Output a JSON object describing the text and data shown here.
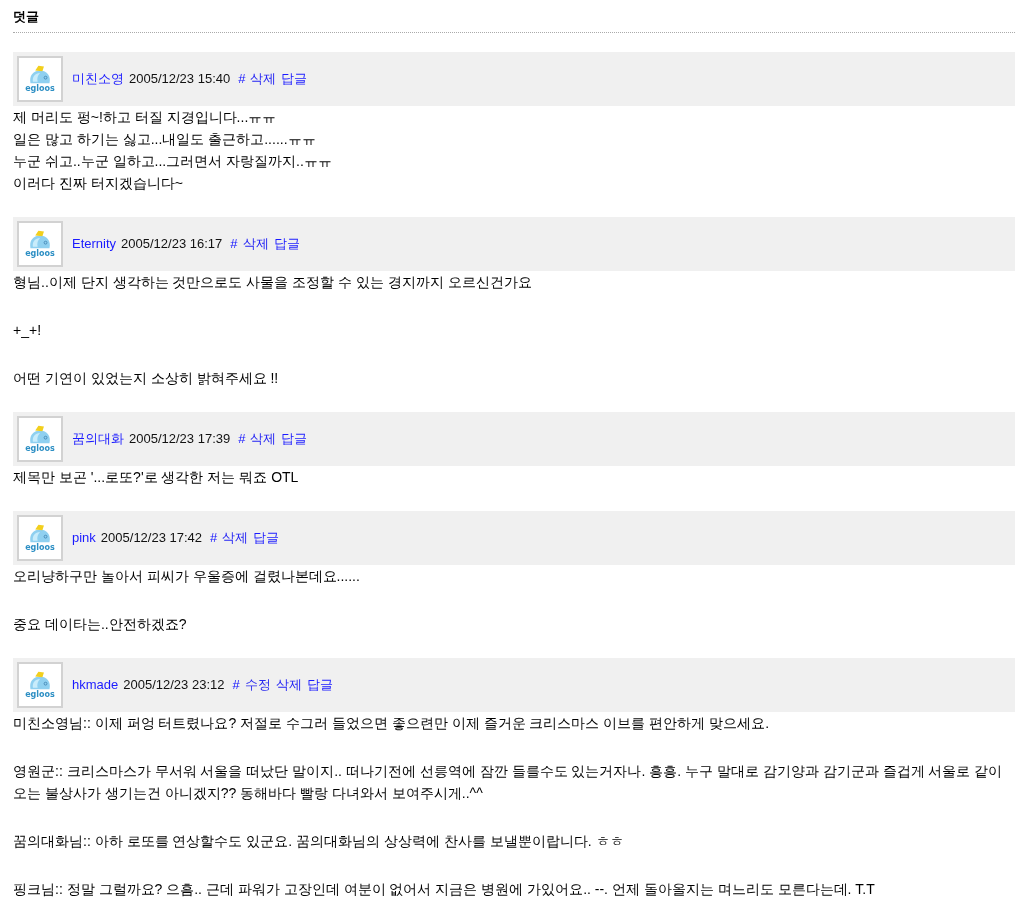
{
  "section": {
    "title": "덧글"
  },
  "comments": [
    {
      "author": "미친소영",
      "date": "2005/12/23 15:40",
      "avatar": {
        "logo_text": "egloos"
      },
      "actions": [
        {
          "kind": "permalink",
          "label": "#"
        },
        {
          "kind": "delete",
          "label": "삭제"
        },
        {
          "kind": "reply",
          "label": "답글"
        }
      ],
      "paragraphs": [
        {
          "lines": [
            "제 머리도 펑~!하고 터질 지경입니다...ㅠㅠ",
            "일은 많고 하기는 싫고...내일도 출근하고......ㅠㅠ",
            "누군 쉬고..누군 일하고...그러면서 자랑질까지..ㅠㅠ",
            "이러다 진짜 터지겠습니다~"
          ]
        }
      ]
    },
    {
      "author": "Eternity",
      "date": "2005/12/23 16:17",
      "avatar": {
        "logo_text": "egloos"
      },
      "actions": [
        {
          "kind": "permalink",
          "label": "#"
        },
        {
          "kind": "delete",
          "label": "삭제"
        },
        {
          "kind": "reply",
          "label": "답글"
        }
      ],
      "paragraphs": [
        {
          "lines": [
            "형님..이제 단지 생각하는 것만으로도 사물을 조정할 수 있는 경지까지 오르신건가요"
          ]
        },
        {
          "lines": [
            "+_+!"
          ]
        },
        {
          "lines": [
            "어떤 기연이 있었는지 소상히 밝혀주세요 !!"
          ]
        }
      ]
    },
    {
      "author": "꿈의대화",
      "date": "2005/12/23 17:39",
      "avatar": {
        "logo_text": "egloos"
      },
      "actions": [
        {
          "kind": "permalink",
          "label": "#"
        },
        {
          "kind": "delete",
          "label": "삭제"
        },
        {
          "kind": "reply",
          "label": "답글"
        }
      ],
      "paragraphs": [
        {
          "lines": [
            "제목만 보곤 '...로또?'로 생각한 저는 뭐죠 OTL"
          ]
        }
      ]
    },
    {
      "author": "pink",
      "date": "2005/12/23 17:42",
      "avatar": {
        "logo_text": "egloos"
      },
      "actions": [
        {
          "kind": "permalink",
          "label": "#"
        },
        {
          "kind": "delete",
          "label": "삭제"
        },
        {
          "kind": "reply",
          "label": "답글"
        }
      ],
      "paragraphs": [
        {
          "lines": [
            "오리냥하구만 놀아서 피씨가 우울증에 걸렸나본데요......"
          ]
        },
        {
          "lines": [
            "중요 데이타는..안전하겠죠?"
          ]
        }
      ]
    },
    {
      "author": "hkmade",
      "date": "2005/12/23 23:12",
      "avatar": {
        "logo_text": "egloos"
      },
      "actions": [
        {
          "kind": "permalink",
          "label": "#"
        },
        {
          "kind": "edit",
          "label": "수정"
        },
        {
          "kind": "delete",
          "label": "삭제"
        },
        {
          "kind": "reply",
          "label": "답글"
        }
      ],
      "paragraphs": [
        {
          "lines": [
            "미친소영님:: 이제 퍼엉 터트렸나요? 저절로 수그러 들었으면 좋으련만 이제 즐거운 크리스마스 이브를 편안하게 맞으세요."
          ]
        },
        {
          "lines": [
            "영원군:: 크리스마스가 무서워 서울을 떠났단 말이지.. 떠나기전에 선릉역에 잠깐 들를수도 있는거자나. 흥흥. 누구 말대로 감기양과 감기군과 즐겁게 서울로 같이 오는 불상사가 생기는건 아니겠지?? 동해바다 빨랑 다녀와서 보여주시게..^^"
          ]
        },
        {
          "lines": [
            "꿈의대화님:: 아하 로또를 연상할수도 있군요. 꿈의대화님의 상상력에 찬사를 보낼뿐이랍니다. ㅎㅎ"
          ]
        },
        {
          "lines": [
            "핑크님:: 정말 그럴까요? 으흠.. 근데 파워가 고장인데 여분이 없어서 지금은 병원에 가있어요.. --. 언제 돌아올지는 며느리도 모른다는데. T.T"
          ]
        }
      ]
    }
  ]
}
